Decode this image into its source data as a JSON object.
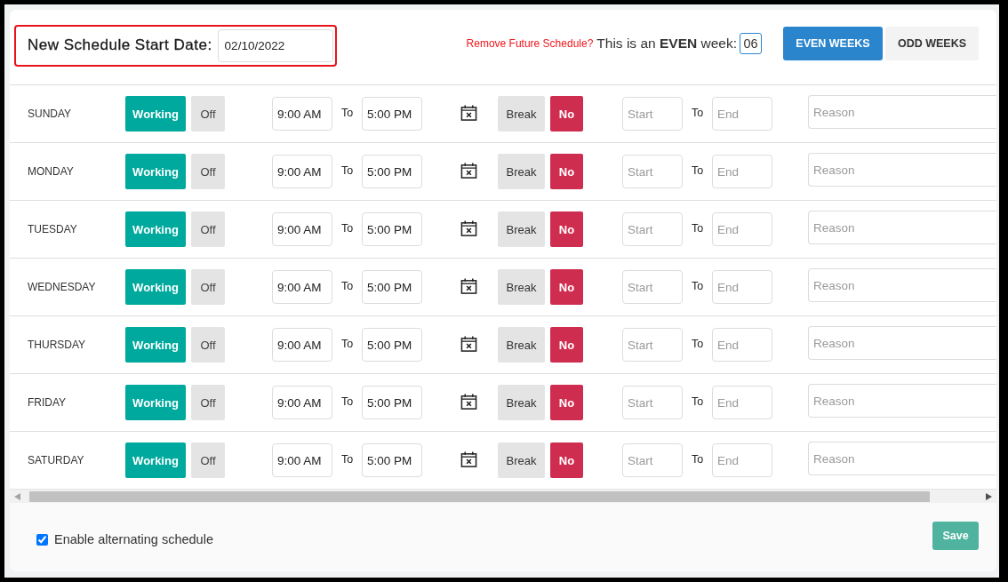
{
  "header": {
    "start_date": {
      "label": "New Schedule Start Date:",
      "value": "02/10/2022"
    },
    "remove_link": "Remove Future Schedule?",
    "week_text": "This is an **EVEN** week:",
    "week_number": "06",
    "week_tabs": [
      {
        "label": "EVEN WEEKS",
        "selected": true
      },
      {
        "label": "ODD WEEKS",
        "selected": false
      }
    ]
  },
  "schedule": {
    "rows": [
      {
        "day": "SUNDAY",
        "status": [
          {
            "label": "Working",
            "selected": true
          },
          {
            "label": "Off",
            "selected": false
          }
        ],
        "start_time": "9:00 AM",
        "to_label": "To",
        "end_time": "5:00 PM",
        "break": [
          {
            "label": "Break",
            "selected": false
          },
          {
            "label": "No",
            "selected": true
          }
        ],
        "break_start": {
          "placeholder": "Start"
        },
        "break_to_label": "To",
        "break_end": {
          "placeholder": "End"
        },
        "reason": {
          "placeholder": "Reason"
        }
      },
      {
        "day": "MONDAY",
        "status": [
          {
            "label": "Working",
            "selected": true
          },
          {
            "label": "Off",
            "selected": false
          }
        ],
        "start_time": "9:00 AM",
        "to_label": "To",
        "end_time": "5:00 PM",
        "break": [
          {
            "label": "Break",
            "selected": false
          },
          {
            "label": "No",
            "selected": true
          }
        ],
        "break_start": {
          "placeholder": "Start"
        },
        "break_to_label": "To",
        "break_end": {
          "placeholder": "End"
        },
        "reason": {
          "placeholder": "Reason"
        }
      },
      {
        "day": "TUESDAY",
        "status": [
          {
            "label": "Working",
            "selected": true
          },
          {
            "label": "Off",
            "selected": false
          }
        ],
        "start_time": "9:00 AM",
        "to_label": "To",
        "end_time": "5:00 PM",
        "break": [
          {
            "label": "Break",
            "selected": false
          },
          {
            "label": "No",
            "selected": true
          }
        ],
        "break_start": {
          "placeholder": "Start"
        },
        "break_to_label": "To",
        "break_end": {
          "placeholder": "End"
        },
        "reason": {
          "placeholder": "Reason"
        }
      },
      {
        "day": "WEDNESDAY",
        "status": [
          {
            "label": "Working",
            "selected": true
          },
          {
            "label": "Off",
            "selected": false
          }
        ],
        "start_time": "9:00 AM",
        "to_label": "To",
        "end_time": "5:00 PM",
        "break": [
          {
            "label": "Break",
            "selected": false
          },
          {
            "label": "No",
            "selected": true
          }
        ],
        "break_start": {
          "placeholder": "Start"
        },
        "break_to_label": "To",
        "break_end": {
          "placeholder": "End"
        },
        "reason": {
          "placeholder": "Reason"
        }
      },
      {
        "day": "THURSDAY",
        "status": [
          {
            "label": "Working",
            "selected": true
          },
          {
            "label": "Off",
            "selected": false
          }
        ],
        "start_time": "9:00 AM",
        "to_label": "To",
        "end_time": "5:00 PM",
        "break": [
          {
            "label": "Break",
            "selected": false
          },
          {
            "label": "No",
            "selected": true
          }
        ],
        "break_start": {
          "placeholder": "Start"
        },
        "break_to_label": "To",
        "break_end": {
          "placeholder": "End"
        },
        "reason": {
          "placeholder": "Reason"
        }
      },
      {
        "day": "FRIDAY",
        "status": [
          {
            "label": "Working",
            "selected": true
          },
          {
            "label": "Off",
            "selected": false
          }
        ],
        "start_time": "9:00 AM",
        "to_label": "To",
        "end_time": "5:00 PM",
        "break": [
          {
            "label": "Break",
            "selected": false
          },
          {
            "label": "No",
            "selected": true
          }
        ],
        "break_start": {
          "placeholder": "Start"
        },
        "break_to_label": "To",
        "break_end": {
          "placeholder": "End"
        },
        "reason": {
          "placeholder": "Reason"
        }
      },
      {
        "day": "SATURDAY",
        "status": [
          {
            "label": "Working",
            "selected": true
          },
          {
            "label": "Off",
            "selected": false
          }
        ],
        "start_time": "9:00 AM",
        "to_label": "To",
        "end_time": "5:00 PM",
        "break": [
          {
            "label": "Break",
            "selected": false
          },
          {
            "label": "No",
            "selected": true
          }
        ],
        "break_start": {
          "placeholder": "Start"
        },
        "break_to_label": "To",
        "break_end": {
          "placeholder": "End"
        },
        "reason": {
          "placeholder": "Reason"
        }
      }
    ]
  },
  "footer": {
    "alternating": {
      "label": "Enable alternating schedule",
      "checked": true
    },
    "save_button": {
      "label": "Save",
      "disabled": true
    }
  }
}
